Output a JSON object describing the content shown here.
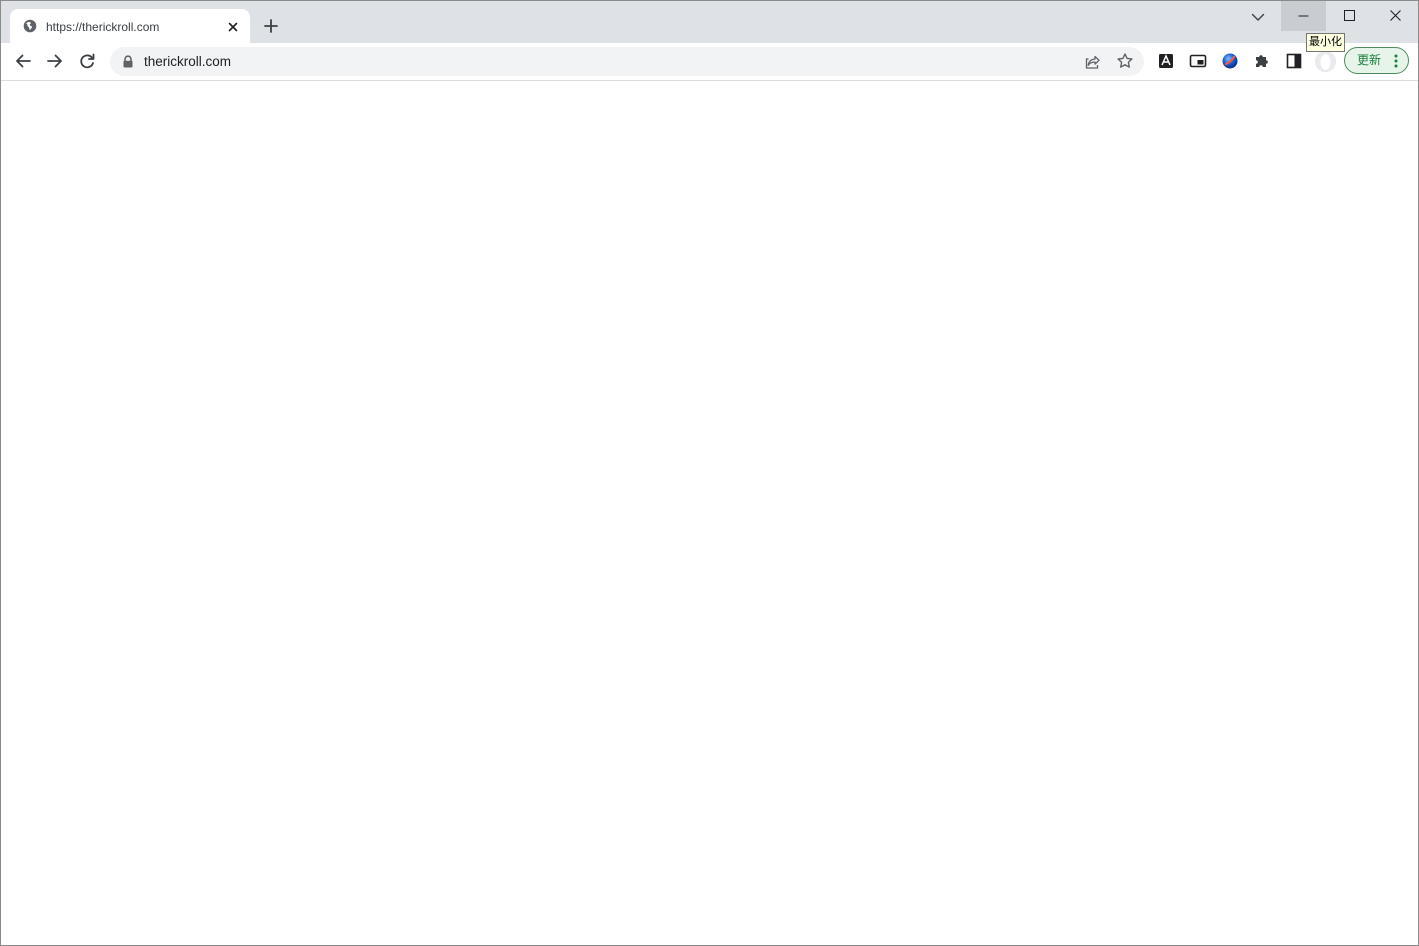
{
  "tab": {
    "title": "https://therickroll.com"
  },
  "toolbar": {
    "url": "therickroll.com",
    "update_label": "更新"
  },
  "window": {
    "minimize_tooltip": "最小化"
  },
  "icons": {
    "tab_favicon": "globe-icon",
    "tab_close": "close-icon",
    "new_tab": "plus-icon",
    "tab_search": "chevron-down-icon",
    "back": "arrow-left-icon",
    "forward": "arrow-right-icon",
    "reload": "reload-icon",
    "lock": "lock-icon",
    "share": "share-icon",
    "bookmark": "star-icon",
    "extensions": [
      "extension-a-icon",
      "picture-in-picture-icon",
      "extension-sphere-icon",
      "puzzle-icon",
      "side-panel-icon"
    ],
    "menu": "kebab-menu-icon"
  },
  "colors": {
    "tabstrip_bg": "#dee1e6",
    "omnibox_bg": "#f1f3f4",
    "update_text": "#188038",
    "update_border": "#4e8c5d",
    "update_bg": "#e6f4ea",
    "tooltip_bg": "#ffffe1"
  }
}
